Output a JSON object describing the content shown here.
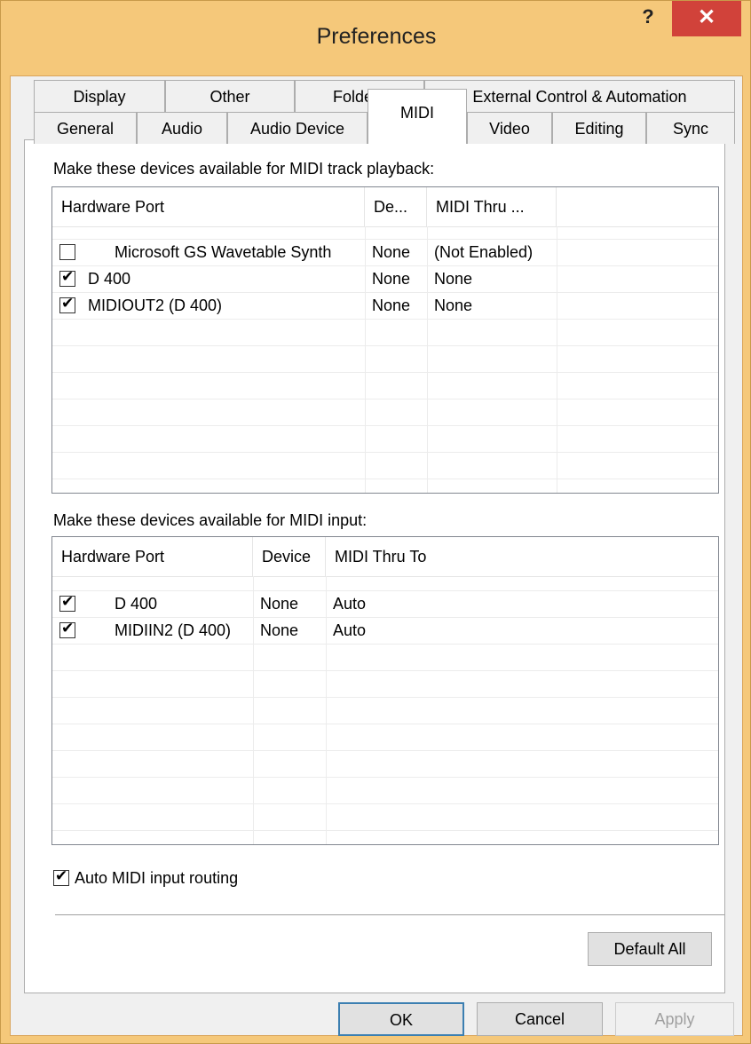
{
  "window": {
    "title": "Preferences",
    "help_label": "?",
    "close_label": "✕"
  },
  "tabs": {
    "back_row": [
      "Display",
      "Other",
      "Folders",
      "External Control & Automation"
    ],
    "front_row": [
      "General",
      "Audio",
      "Audio Device",
      "MIDI",
      "Video",
      "Editing",
      "Sync"
    ],
    "active": "MIDI"
  },
  "playback": {
    "label": "Make these devices available for MIDI track playback:",
    "columns": [
      "Hardware Port",
      "De...",
      "MIDI Thru ..."
    ],
    "rows": [
      {
        "checked": false,
        "port": "Microsoft GS Wavetable Synth",
        "device": "None",
        "thru": "(Not Enabled)"
      },
      {
        "checked": true,
        "port": "D 400",
        "device": "None",
        "thru": "None"
      },
      {
        "checked": true,
        "port": "MIDIOUT2 (D 400)",
        "device": "None",
        "thru": "None"
      }
    ]
  },
  "input": {
    "label": "Make these devices available for MIDI input:",
    "columns": [
      "Hardware Port",
      "Device",
      "MIDI Thru To"
    ],
    "rows": [
      {
        "checked": true,
        "port": "D 400",
        "device": "None",
        "thru": "Auto"
      },
      {
        "checked": true,
        "port": "MIDIIN2 (D 400)",
        "device": "None",
        "thru": "Auto"
      }
    ]
  },
  "auto_routing": {
    "checked": true,
    "label": "Auto MIDI input routing"
  },
  "buttons": {
    "default_all": "Default All",
    "ok": "OK",
    "cancel": "Cancel",
    "apply": "Apply"
  }
}
